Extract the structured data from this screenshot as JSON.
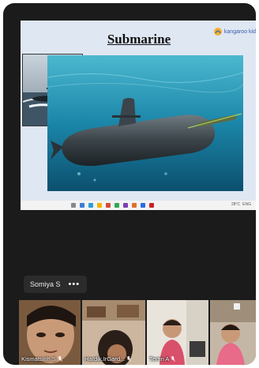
{
  "shared_screen": {
    "slide_title": "Submarine",
    "brand_name": "kangaroo kid"
  },
  "presenter": {
    "name": "Somiya S",
    "more_label": "•••"
  },
  "participants": [
    {
      "name": "Kismatsinh S",
      "muted": true
    },
    {
      "name": "Hardik.IrGard...",
      "muted": true
    },
    {
      "name": "Terrin A",
      "muted": true
    },
    {
      "name": "",
      "muted": false
    }
  ],
  "taskbar_tray": [
    "28°C",
    "ENG"
  ],
  "colors": {
    "background": "#1b1b1b",
    "slide_bg": "#dfe7f3",
    "ocean": "#1b7fa8",
    "brand": "#3a5ca8"
  }
}
